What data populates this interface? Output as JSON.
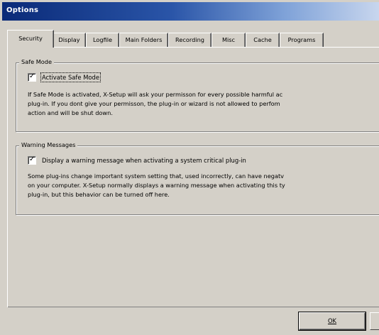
{
  "window": {
    "title": "Options"
  },
  "tabs": [
    {
      "label": "Security",
      "active": true
    },
    {
      "label": "Display"
    },
    {
      "label": "Logfile"
    },
    {
      "label": "Main Folders"
    },
    {
      "label": "Recording"
    },
    {
      "label": "Misc"
    },
    {
      "label": "Cache"
    },
    {
      "label": "Programs"
    }
  ],
  "safe_mode": {
    "group_title": "Safe Mode",
    "checkbox_label": "Activate Safe Mode",
    "checked": true,
    "description": [
      "If Safe Mode is activated, X-Setup will ask your permisson for every possible harmful ac",
      "plug-in. If you dont give your permisson, the plug-in or wizard is not allowed to perfom",
      "action and will be shut down."
    ]
  },
  "warning_messages": {
    "group_title": "Warning Messages",
    "checkbox_label": "Display a warning message when activating a system critical plug-in",
    "checked": true,
    "description": [
      "Some plug-ins change important system setting that, used incorrectly, can have negatv",
      "on your computer. X-Setup normally displays a warning message when activating this ty",
      "plug-in, but this behavior can be turned off here."
    ]
  },
  "buttons": {
    "ok_label": "OK"
  }
}
